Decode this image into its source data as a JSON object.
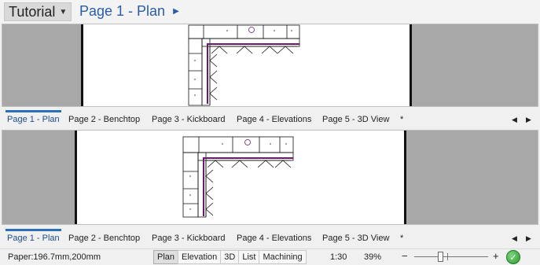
{
  "header": {
    "project": "Tutorial",
    "page_title": "Page 1 - Plan"
  },
  "tabs": [
    {
      "label": "Page 1 - Plan",
      "active": true
    },
    {
      "label": "Page 2 - Benchtop",
      "active": false
    },
    {
      "label": "Page 3 - Kickboard",
      "active": false
    },
    {
      "label": "Page 4 - Elevations",
      "active": false
    },
    {
      "label": "Page 5 - 3D View",
      "active": false
    },
    {
      "label": "*",
      "active": false
    }
  ],
  "nav": {
    "prev": "◀",
    "next": "▶"
  },
  "status": {
    "paper": "Paper:196.7mm,200mm",
    "views": [
      "Plan",
      "Elevation",
      "3D",
      "List",
      "Machining"
    ],
    "selected_view": "Plan",
    "scale": "1:30",
    "zoom": "39%",
    "zoom_minus": "−",
    "zoom_plus": "+",
    "zoom_level": 0.35
  },
  "colors": {
    "accent": "#2a6fb8",
    "title_text": "#2a5da8",
    "bench_edge": "#6b1a6b",
    "canvas_bg": "#a8a8a8"
  }
}
